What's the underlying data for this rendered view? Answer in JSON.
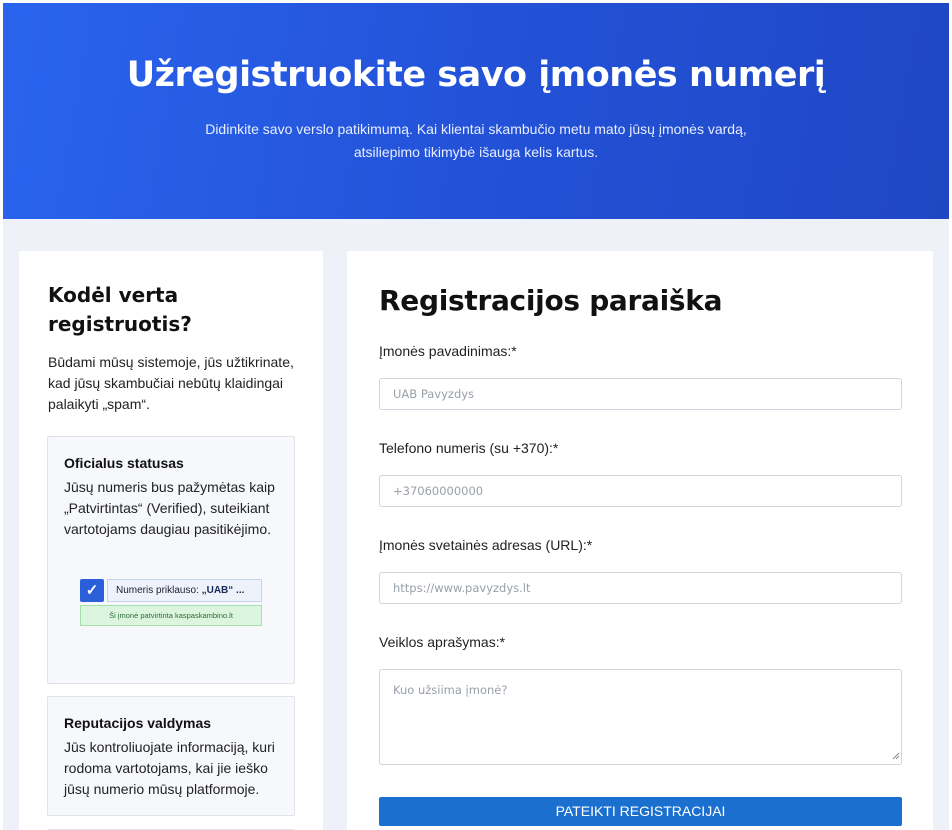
{
  "hero": {
    "title": "Užregistruokite savo įmonės numerį",
    "subtitle": "Didinkite savo verslo patikimumą. Kai klientai skambučio metu mato jūsų įmonės vardą, atsiliepimo tikimybė išauga kelis kartus."
  },
  "sidebar": {
    "title": "Kodėl verta registruotis?",
    "intro": "Būdami mūsų sistemoje, jūs užtikrinate, kad jūsų skambučiai nebūtų klaidingai palaikyti „spam“.",
    "cards": [
      {
        "title": "Oficialus statusas",
        "text": "Jūsų numeris bus pažymėtas kaip „Patvirtintas“ (Verified), suteikiant vartotojams daugiau pasitikėjimo.",
        "badge": {
          "check": "✓",
          "owner_prefix": "Numeris priklauso:",
          "owner_name": "„UAB“ ...",
          "verified_text": "Ši įmonė patvirtinta kaspaskambino.lt"
        }
      },
      {
        "title": "Reputacijos valdymas",
        "text": "Jūs kontroliuojate informaciją, kuri rodoma vartotojams, kai jie ieško jūsų numerio mūsų platformoje."
      }
    ]
  },
  "form": {
    "title": "Registracijos paraiška",
    "company_label": "Įmonės pavadinimas:*",
    "company_placeholder": "UAB Pavyzdys",
    "phone_label": "Telefono numeris (su +370):*",
    "phone_placeholder": "+37060000000",
    "website_label": "Įmonės svetainės adresas (URL):*",
    "website_placeholder": "https://www.pavyzdys.lt",
    "description_label": "Veiklos aprašymas:*",
    "description_placeholder": "Kuo užsiima įmonė?",
    "submit_label": "PATEIKTI REGISTRACIJAI"
  },
  "colors": {
    "hero_gradient_start": "#2a64ee",
    "hero_gradient_end": "#1f47c4",
    "submit_button": "#1a6fcf",
    "page_background": "#eef1f8"
  }
}
